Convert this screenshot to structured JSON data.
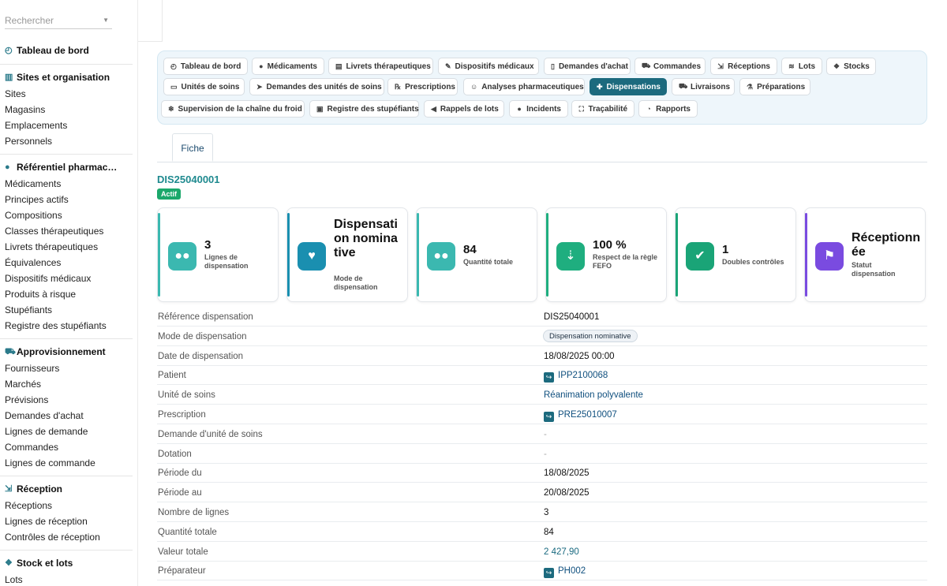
{
  "sidebar": {
    "search_placeholder": "Rechercher",
    "dashboard": "Tableau de bord",
    "sections": [
      {
        "title": "Sites et organisation",
        "items": [
          "Sites",
          "Magasins",
          "Emplacements",
          "Personnels"
        ]
      },
      {
        "title": "Référentiel pharmac…",
        "items": [
          "Médicaments",
          "Principes actifs",
          "Compositions",
          "Classes thérapeutiques",
          "Livrets thérapeutiques",
          "Équivalences",
          "Dispositifs médicaux",
          "Produits à risque",
          "Stupéfiants",
          "Registre des stupéfiants"
        ]
      },
      {
        "title": "Approvisionnement",
        "items": [
          "Fournisseurs",
          "Marchés",
          "Prévisions",
          "Demandes d'achat",
          "Lignes de demande",
          "Commandes",
          "Lignes de commande"
        ]
      },
      {
        "title": "Réception",
        "items": [
          "Réceptions",
          "Lignes de réception",
          "Contrôles de réception"
        ]
      },
      {
        "title": "Stock et lots",
        "items": [
          "Lots"
        ]
      }
    ]
  },
  "nav": {
    "chips": [
      {
        "label": "Tableau de bord",
        "icon": "dashboard-icon",
        "glyph": "◴"
      },
      {
        "label": "Médicaments",
        "icon": "pills-icon",
        "glyph": "●"
      },
      {
        "label": "Livrets thérapeutiques",
        "icon": "book-icon",
        "glyph": "▤"
      },
      {
        "label": "Dispositifs médicaux",
        "icon": "syringe-icon",
        "glyph": "✎"
      },
      {
        "label": "Demandes d'achat",
        "icon": "file-icon",
        "glyph": "▯"
      },
      {
        "label": "Commandes",
        "icon": "cart-icon",
        "glyph": "⛟"
      },
      {
        "label": "Réceptions",
        "icon": "truck-loading-icon",
        "glyph": "⇲"
      },
      {
        "label": "Lots",
        "icon": "layers-icon",
        "glyph": "≋"
      },
      {
        "label": "Stocks",
        "icon": "cubes-icon",
        "glyph": "❖"
      },
      {
        "label": "Unités de soins",
        "icon": "bed-icon",
        "glyph": "▭"
      },
      {
        "label": "Demandes des unités de soins",
        "icon": "paper-plane-icon",
        "glyph": "➤"
      },
      {
        "label": "Prescriptions",
        "icon": "prescription-icon",
        "glyph": "℞"
      },
      {
        "label": "Analyses pharmaceutiques",
        "icon": "user-doctor-icon",
        "glyph": "☺"
      },
      {
        "label": "Dispensations",
        "icon": "hand-holding-icon",
        "glyph": "✚"
      },
      {
        "label": "Livraisons",
        "icon": "truck-icon",
        "glyph": "⛟"
      },
      {
        "label": "Préparations",
        "icon": "mortar-icon",
        "glyph": "⚗"
      },
      {
        "label": "Supervision de la chaîne du froid",
        "icon": "snowflake-icon",
        "glyph": "❄"
      },
      {
        "label": "Registre des stupéfiants",
        "icon": "lock-icon",
        "glyph": "▣"
      },
      {
        "label": "Rappels de lots",
        "icon": "bullhorn-icon",
        "glyph": "◀"
      },
      {
        "label": "Incidents",
        "icon": "alert-circle-icon",
        "glyph": "●"
      },
      {
        "label": "Traçabilité",
        "icon": "sitemap-icon",
        "glyph": "⛶"
      },
      {
        "label": "Rapports",
        "icon": "chart-pie-icon",
        "glyph": "◔"
      }
    ],
    "active": "Dispensations"
  },
  "tab": "Fiche",
  "record": {
    "title": "DIS25040001",
    "status_badge": "Actif"
  },
  "cards": [
    {
      "value": "3",
      "label": "Lignes de dispensation",
      "icon": "pills-icon",
      "glyph": "●●",
      "color": "#3bb8b0"
    },
    {
      "value": "Dispensation nominative",
      "label": "Mode de dispensation",
      "icon": "hand-holding-heart-icon",
      "glyph": "♥",
      "color": "#1a8fb0"
    },
    {
      "value": "84",
      "label": "Quantité totale",
      "icon": "pills-icon",
      "glyph": "●●",
      "color": "#3bb8b0"
    },
    {
      "value": "100 %",
      "label": "Respect de la règle FEFO",
      "icon": "sort-down-icon",
      "glyph": "⇣",
      "color": "#1fae7f"
    },
    {
      "value": "1",
      "label": "Doubles contrôles",
      "icon": "double-check-icon",
      "glyph": "✔",
      "color": "#1aa477"
    },
    {
      "value": "Réceptionnée",
      "label": "Statut dispensation",
      "icon": "flag-icon",
      "glyph": "⚑",
      "color": "#7a4be0"
    }
  ],
  "details": [
    {
      "key": "Référence dispensation",
      "value": "DIS25040001",
      "type": "text"
    },
    {
      "key": "Mode de dispensation",
      "value": "Dispensation nominative",
      "type": "pill"
    },
    {
      "key": "Date de dispensation",
      "value": "18/08/2025 00:00",
      "type": "text"
    },
    {
      "key": "Patient",
      "value": "IPP2100068",
      "type": "link"
    },
    {
      "key": "Unité de soins",
      "value": "Réanimation polyvalente",
      "type": "plainlink"
    },
    {
      "key": "Prescription",
      "value": "PRE25010007",
      "type": "link"
    },
    {
      "key": "Demande d'unité de soins",
      "value": "-",
      "type": "dash"
    },
    {
      "key": "Dotation",
      "value": "-",
      "type": "dash"
    },
    {
      "key": "Période du",
      "value": "18/08/2025",
      "type": "text"
    },
    {
      "key": "Période au",
      "value": "20/08/2025",
      "type": "text"
    },
    {
      "key": "Nombre de lignes",
      "value": "3",
      "type": "text"
    },
    {
      "key": "Quantité totale",
      "value": "84",
      "type": "text"
    },
    {
      "key": "Valeur totale",
      "value": "2 427,90",
      "type": "money"
    },
    {
      "key": "Préparateur",
      "value": "PH002",
      "type": "link"
    }
  ]
}
